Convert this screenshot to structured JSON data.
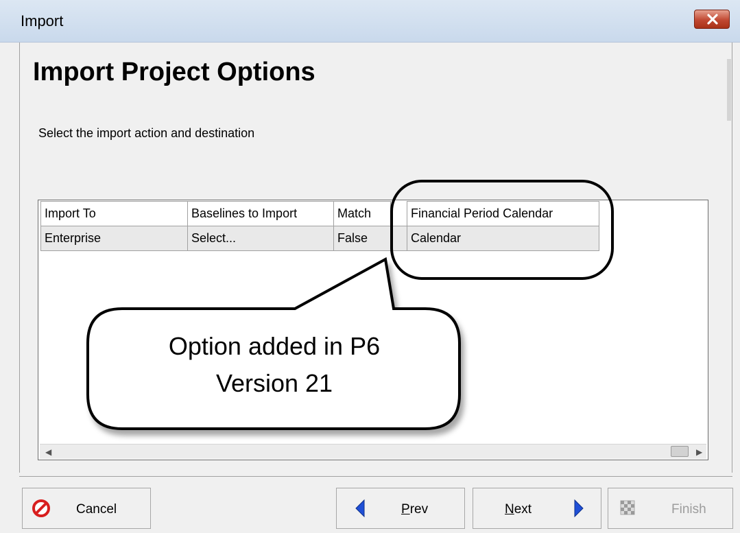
{
  "window": {
    "title": "Import"
  },
  "header": {
    "title": "Import Project Options",
    "subtitle": "Select the import action and destination"
  },
  "grid": {
    "columns": [
      "Import To",
      "Baselines to Import",
      "Match",
      "Financial Period Calendar"
    ],
    "rows": [
      [
        "Enterprise",
        "Select...",
        "False",
        "Calendar"
      ]
    ]
  },
  "callout": {
    "line1": "Option added in P6",
    "line2": "Version 21"
  },
  "buttons": {
    "cancel": "Cancel",
    "prev_pre": "",
    "prev_ul": "P",
    "prev_post": "rev",
    "next_ul": "N",
    "next_post": "ext",
    "finish": "Finish"
  },
  "colors": {
    "prev_next_arrow": "#1f4fd6",
    "cancel_icon": "#d81e1e"
  }
}
